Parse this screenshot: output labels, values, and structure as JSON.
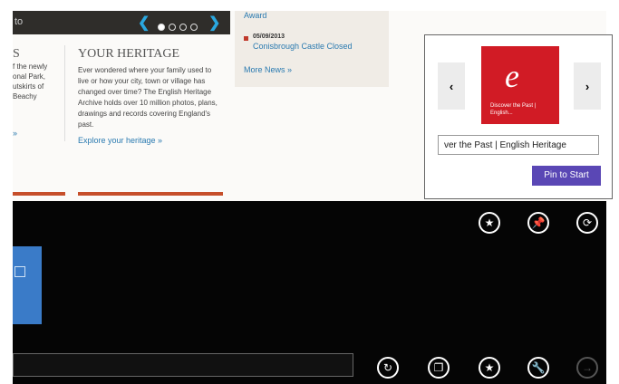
{
  "slider": {
    "nav_text": "to",
    "prev_symbol": "❮",
    "next_symbol": "❯"
  },
  "left_column": {
    "title": "S",
    "lines": [
      "f the newly",
      "onal Park,",
      "utskirts of",
      "Beachy"
    ],
    "link_arrow": "»"
  },
  "heritage": {
    "title": "YOUR HERITAGE",
    "body": "Ever wondered where your family used to live or how your city, town or village has changed over time? The English Heritage Archive holds over 10 million photos, plans, drawings and records covering England's past.",
    "link": "Explore your heritage »"
  },
  "news": {
    "award_text": "Award",
    "item_date": "05/09/2013",
    "item_title": "Conisbrough Castle Closed",
    "more": "More News »"
  },
  "pin_panel": {
    "prev_arrow": "‹",
    "next_arrow": "›",
    "tile_logo": "e",
    "tile_label": "Discover the Past | English...",
    "name_value": "ver the Past | English Heritage",
    "pin_label": "Pin to Start"
  },
  "appbar_top_icons": [
    {
      "name": "favorites-icon",
      "glyph": "★"
    },
    {
      "name": "pin-icon",
      "glyph": "📌"
    },
    {
      "name": "sync-icon",
      "glyph": "⟳"
    }
  ],
  "appbar_bottom_icons": [
    {
      "name": "refresh-icon",
      "glyph": "↻"
    },
    {
      "name": "tabs-icon",
      "glyph": "❐"
    },
    {
      "name": "favorite-star-icon",
      "glyph": "★"
    },
    {
      "name": "tools-icon",
      "glyph": "🔧"
    },
    {
      "name": "forward-icon",
      "glyph": "→"
    }
  ],
  "colors": {
    "accent_purple": "#5a47b5",
    "tile_red": "#d11b25",
    "link_blue": "#2a7ab0",
    "appbar_black": "#050505"
  }
}
